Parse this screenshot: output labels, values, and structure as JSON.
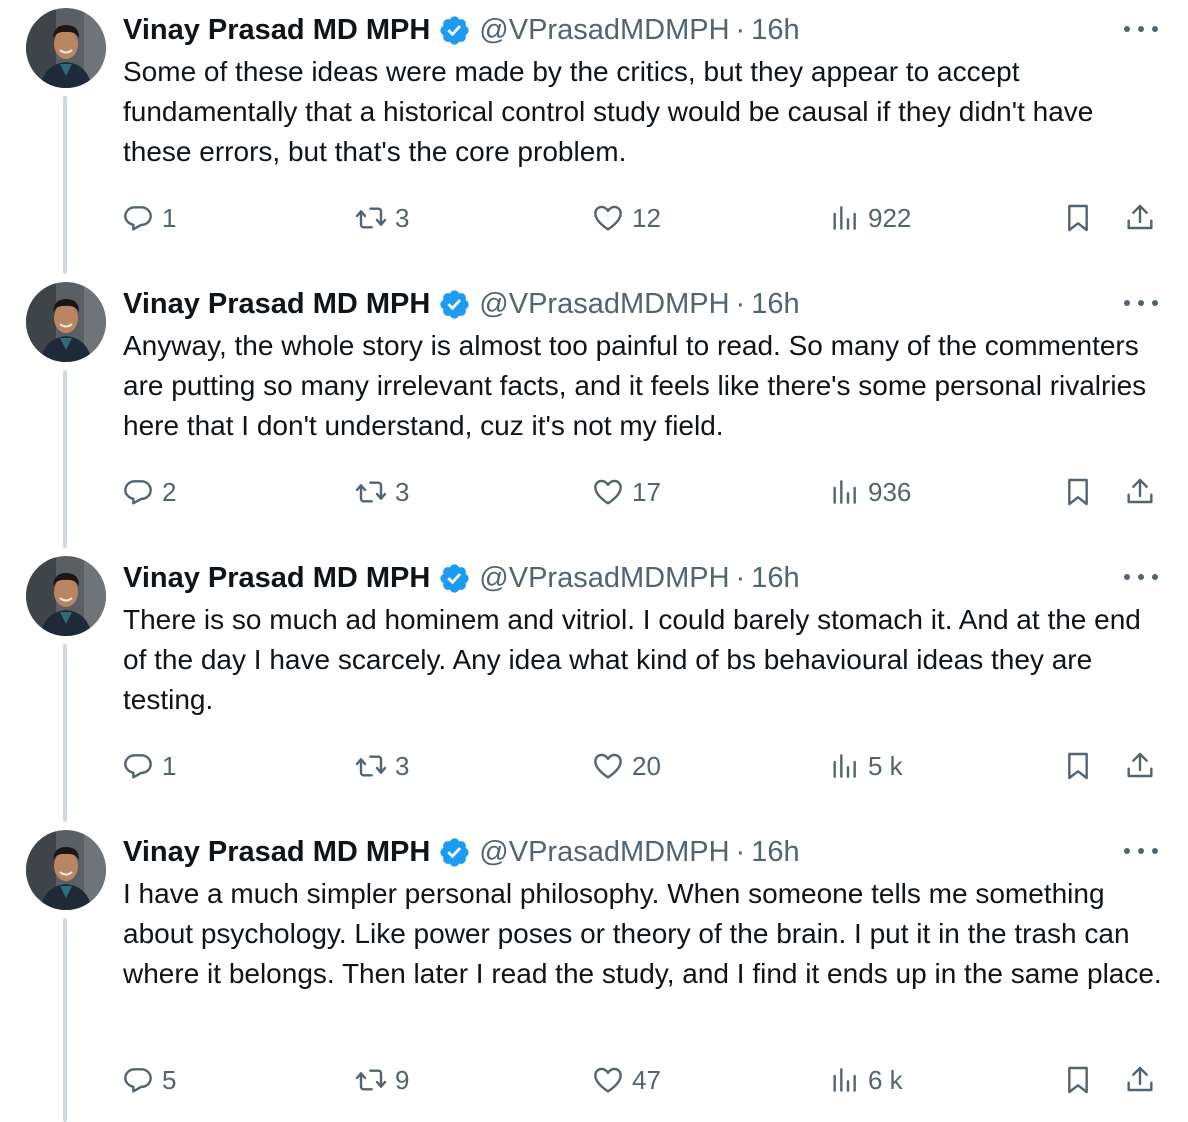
{
  "colors": {
    "text": "#0f1419",
    "secondary": "#536471",
    "verified": "#1d9bf0",
    "thread_line": "#cfd9de"
  },
  "icons": {
    "reply": "speech-bubble-icon",
    "retweet": "retweet-arrows-icon",
    "like": "heart-icon",
    "views": "bar-chart-icon",
    "bookmark": "bookmark-icon",
    "share": "share-upload-icon",
    "verified": "verified-badge-icon",
    "more": "more-dots-icon"
  },
  "tweets": [
    {
      "name": "Vinay Prasad MD MPH",
      "handle": "@VPrasadMDMPH",
      "separator": "·",
      "time": "16h",
      "text": "Some of these ideas were made by the critics, but they appear to accept fundamentally that a historical control study would be causal if they didn't have these errors, but that's the core problem.",
      "replies": "1",
      "retweets": "3",
      "likes": "12",
      "views": "922"
    },
    {
      "name": "Vinay Prasad MD MPH",
      "handle": "@VPrasadMDMPH",
      "separator": "·",
      "time": "16h",
      "text": "Anyway, the whole story is almost too painful to read. So many of the commenters are putting so many irrelevant facts, and it feels like there's some personal rivalries here that I don't understand, cuz it's not my field.",
      "replies": "2",
      "retweets": "3",
      "likes": "17",
      "views": "936"
    },
    {
      "name": "Vinay Prasad MD MPH",
      "handle": "@VPrasadMDMPH",
      "separator": "·",
      "time": "16h",
      "text": "There is so much ad hominem and vitriol. I could barely stomach it. And at the end of the day I have scarcely. Any idea what kind of bs behavioural ideas they are testing.",
      "replies": "1",
      "retweets": "3",
      "likes": "20",
      "views": "5 k"
    },
    {
      "name": "Vinay Prasad MD MPH",
      "handle": "@VPrasadMDMPH",
      "separator": "·",
      "time": "16h",
      "text": "I have a much simpler personal philosophy. When someone tells me something about psychology. Like power poses or theory of the brain. I put it in the trash can where it belongs. Then later I read the study, and I find it ends up in the same place.",
      "replies": "5",
      "retweets": "9",
      "likes": "47",
      "views": "6 k"
    }
  ]
}
